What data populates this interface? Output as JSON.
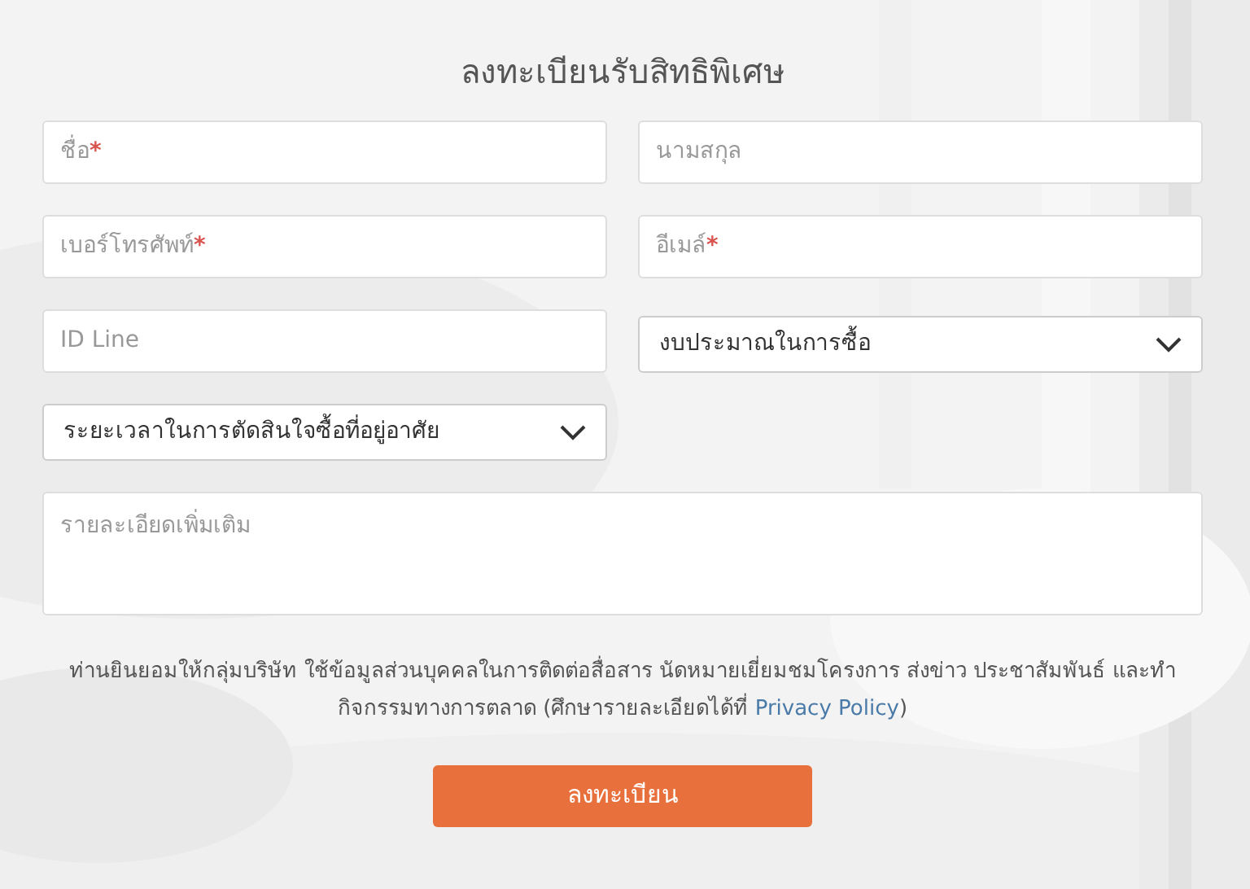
{
  "title": "ลงทะเบียนรับสิทธิพิเศษ",
  "fields": [
    {
      "kind": "text",
      "placeholder": "ชื่อ",
      "required_mark": "*"
    },
    {
      "kind": "text",
      "placeholder": "นามสกุล"
    },
    {
      "kind": "text",
      "placeholder": "เบอร์โทรศัพท์",
      "required_mark": "*"
    },
    {
      "kind": "text",
      "placeholder": "อีเมล์",
      "required_mark": "*"
    },
    {
      "kind": "text",
      "placeholder": "ID Line"
    },
    {
      "kind": "select",
      "value": "งบประมาณในการซื้อ"
    },
    {
      "kind": "select",
      "value": "ระยะเวลาในการตัดสินใจซื้อที่อยู่อาศัย"
    },
    {
      "kind": "textarea",
      "placeholder": "รายละเอียดเพิ่มเติม"
    }
  ],
  "consent": {
    "text": "ท่านยินยอมให้กลุ่มบริษัท ใช้ข้อมูลส่วนบุคคลในการติดต่อสื่อสาร นัดหมายเยี่ยมชมโครงการ ส่งข่าว ประชาสัมพันธ์ และทำกิจกรรมทางการตลาด (ศึกษารายละเอียดได้ที่",
    "link": "Privacy Policy",
    "close": ")"
  },
  "submit": "ลงทะเบียน"
}
